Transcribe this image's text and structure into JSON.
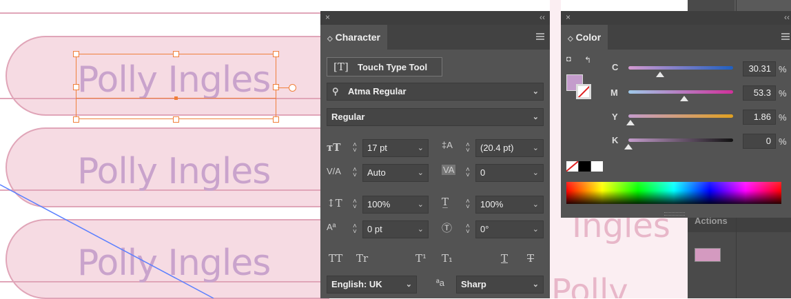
{
  "canvas": {
    "pill_texts": [
      "Polly Ingles",
      "Polly Ingles",
      "Polly Ingles"
    ],
    "behind_text_1": "Ingles",
    "behind_text_2": "Polly",
    "colors": {
      "pill_fill": "#f6dbe3",
      "pill_stroke": "#e0a5b8",
      "text": "#c9a3cc",
      "selection": "#f07f3a",
      "path": "#5a7fff"
    }
  },
  "character_panel": {
    "close": "×",
    "collapse": "‹‹",
    "title": "Character",
    "touch_type_label": "Touch Type Tool",
    "font_family": "Atma Regular",
    "font_style": "Regular",
    "font_size": "17 pt",
    "leading": "(20.4 pt)",
    "kerning": "Auto",
    "tracking": "0",
    "vertical_scale": "100%",
    "horizontal_scale": "100%",
    "baseline_shift": "0 pt",
    "rotation": "0°",
    "style_buttons": {
      "all_caps": "TT",
      "small_caps": "Tr",
      "superscript": "T¹",
      "subscript": "T₁",
      "underline": "T",
      "strike": "T"
    },
    "language": "English: UK",
    "aa_icon": "ªa",
    "anti_alias": "Sharp"
  },
  "color_panel": {
    "close": "×",
    "collapse": "‹‹",
    "title": "Color",
    "channels": [
      {
        "label": "C",
        "value": "30.31",
        "unit": "%",
        "fraction": 0.3031
      },
      {
        "label": "M",
        "value": "53.3",
        "unit": "%",
        "fraction": 0.533
      },
      {
        "label": "Y",
        "value": "1.86",
        "unit": "%",
        "fraction": 0.0186
      },
      {
        "label": "K",
        "value": "0",
        "unit": "%",
        "fraction": 0
      }
    ],
    "fill_color": "#c49ccc"
  },
  "background_panel": {
    "actions_label": "Actions"
  }
}
